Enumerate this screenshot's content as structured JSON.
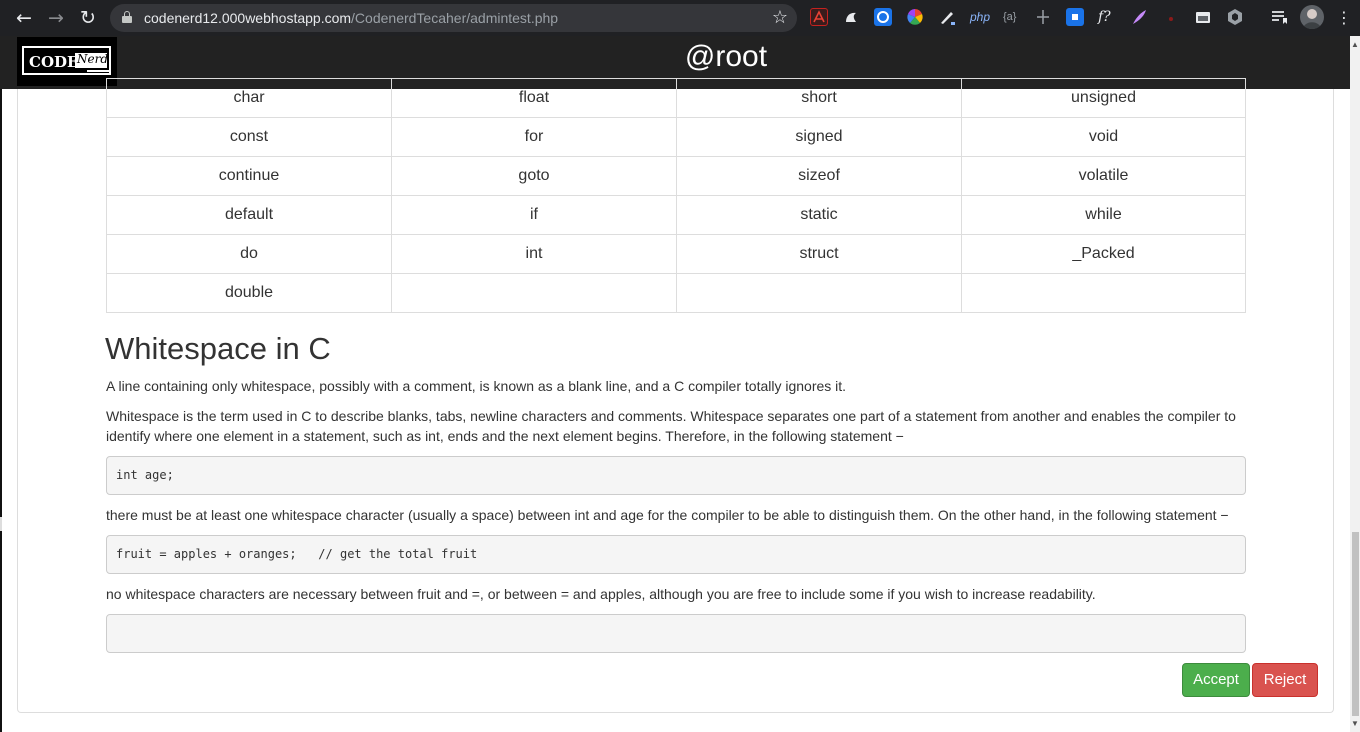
{
  "browser": {
    "url_domain": "codenerd12.000webhostapp.com",
    "url_path": "/CodenerdTecaher/admintest.php",
    "ext_php_label": "php",
    "ext_json_label": "{a}",
    "ext_fx_label": "f?"
  },
  "app": {
    "logo_text_code": "CODE",
    "logo_text_nerd": "Nerd",
    "title": "@root"
  },
  "keywords_table": {
    "rows": [
      [
        "char",
        "float",
        "short",
        "unsigned"
      ],
      [
        "const",
        "for",
        "signed",
        "void"
      ],
      [
        "continue",
        "goto",
        "sizeof",
        "volatile"
      ],
      [
        "default",
        "if",
        "static",
        "while"
      ],
      [
        "do",
        "int",
        "struct",
        "_Packed"
      ],
      [
        "double",
        "",
        "",
        ""
      ]
    ]
  },
  "content": {
    "heading": "Whitespace in C",
    "para1": "A line containing only whitespace, possibly with a comment, is known as a blank line, and a C compiler totally ignores it.",
    "para2": "Whitespace is the term used in C to describe blanks, tabs, newline characters and comments. Whitespace separates one part of a statement from another and enables the compiler to identify where one element in a statement, such as int, ends and the next element begins. Therefore, in the following statement −",
    "code1": "int age;",
    "para3": "there must be at least one whitespace character (usually a space) between int and age for the compiler to be able to distinguish them. On the other hand, in the following statement −",
    "code2": "fruit = apples + oranges;   // get the total fruit",
    "para4": "no whitespace characters are necessary between fruit and =, or between = and apples, although you are free to include some if you wish to increase readability.",
    "code3": ""
  },
  "actions": {
    "accept_label": "Accept",
    "reject_label": "Reject"
  },
  "colors": {
    "accept": "#5cb85c",
    "reject": "#d9534f",
    "header_bg": "#222222",
    "chrome_bg": "#202124"
  }
}
